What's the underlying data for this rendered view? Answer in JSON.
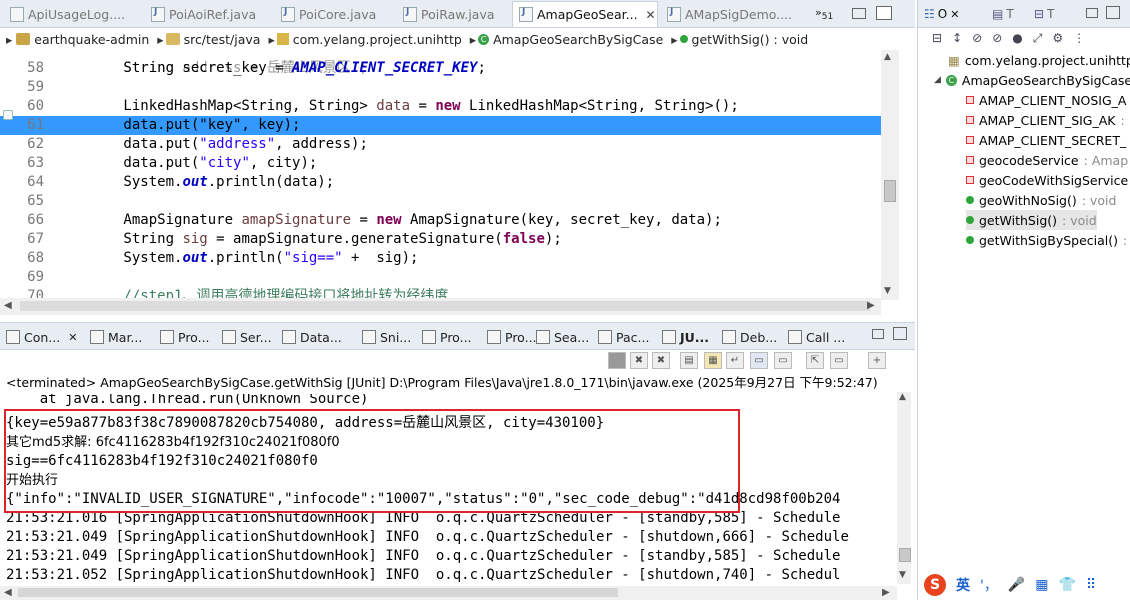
{
  "editor_tabs": [
    {
      "label": "ApiUsageLog....",
      "active": false
    },
    {
      "label": "PoiAoiRef.java",
      "active": false
    },
    {
      "label": "PoiCore.java",
      "active": false
    },
    {
      "label": "PoiRaw.java",
      "active": false
    },
    {
      "label": "AmapGeoSear...",
      "active": true
    },
    {
      "label": "AMapSigDemo....",
      "active": false
    }
  ],
  "overflow_count": "51",
  "breadcrumb": [
    "earthquake-admin",
    "src/test/java",
    "com.yelang.project.unihttp",
    "AmapGeoSearchBySigCase",
    "getWithSig() : void"
  ],
  "code_lines": [
    {
      "n": "58",
      "tokens": [
        {
          "t": "        String secret_key = ",
          "c": ""
        },
        {
          "t": "AMAP_CLIENT_SECRET_KEY",
          "c": "const"
        },
        {
          "t": ";",
          "c": ""
        }
      ]
    },
    {
      "n": "59",
      "tokens": []
    },
    {
      "n": "60",
      "tokens": [
        {
          "t": "        LinkedHashMap<String, String> ",
          "c": ""
        },
        {
          "t": "data",
          "c": "var"
        },
        {
          "t": " = ",
          "c": ""
        },
        {
          "t": "new",
          "c": "kw"
        },
        {
          "t": " LinkedHashMap<String, String>();",
          "c": ""
        }
      ]
    },
    {
      "n": "61",
      "tokens": [
        {
          "t": "        data.put(\"key\", key);",
          "c": ""
        }
      ],
      "highlight": true
    },
    {
      "n": "62",
      "tokens": [
        {
          "t": "        data.put(",
          "c": ""
        },
        {
          "t": "\"address\"",
          "c": "str"
        },
        {
          "t": ", address);",
          "c": ""
        }
      ]
    },
    {
      "n": "63",
      "tokens": [
        {
          "t": "        data.put(",
          "c": ""
        },
        {
          "t": "\"city\"",
          "c": "str"
        },
        {
          "t": ", city);",
          "c": ""
        }
      ]
    },
    {
      "n": "64",
      "tokens": [
        {
          "t": "        System.",
          "c": ""
        },
        {
          "t": "out",
          "c": "fld"
        },
        {
          "t": ".println(data);",
          "c": ""
        }
      ]
    },
    {
      "n": "65",
      "tokens": []
    },
    {
      "n": "66",
      "tokens": [
        {
          "t": "        AmapSignature ",
          "c": ""
        },
        {
          "t": "amapSignature",
          "c": "var"
        },
        {
          "t": " = ",
          "c": ""
        },
        {
          "t": "new",
          "c": "kw"
        },
        {
          "t": " AmapSignature(key, secret_key, data);",
          "c": ""
        }
      ]
    },
    {
      "n": "67",
      "tokens": [
        {
          "t": "        String ",
          "c": ""
        },
        {
          "t": "sig",
          "c": "var"
        },
        {
          "t": " = amapSignature.generateSignature(",
          "c": ""
        },
        {
          "t": "false",
          "c": "kw"
        },
        {
          "t": ");",
          "c": ""
        }
      ]
    },
    {
      "n": "68",
      "tokens": [
        {
          "t": "        System.",
          "c": ""
        },
        {
          "t": "out",
          "c": "fld"
        },
        {
          "t": ".println(",
          "c": ""
        },
        {
          "t": "\"sig==\"",
          "c": "str"
        },
        {
          "t": " +  sig);",
          "c": ""
        }
      ]
    },
    {
      "n": "69",
      "tokens": []
    },
    {
      "n": "70",
      "tokens": [
        {
          "t": "        //step1、调用高德地理编码接口将地址转为经纬度",
          "c": "cmt"
        }
      ]
    }
  ],
  "outline": {
    "tabs": [
      "O",
      "T",
      "T"
    ],
    "package": "com.yelang.project.unihttp",
    "class_name": "AmapGeoSearchBySigCase",
    "members": [
      {
        "icon": "static-final-field",
        "name": "AMAP_CLIENT_NOSIG_A",
        "type": ""
      },
      {
        "icon": "static-final-field",
        "name": "AMAP_CLIENT_SIG_AK",
        "type": " :"
      },
      {
        "icon": "static-final-field",
        "name": "AMAP_CLIENT_SECRET_",
        "type": ""
      },
      {
        "icon": "private-field",
        "name": "geocodeService",
        "type": " : Amap"
      },
      {
        "icon": "private-field",
        "name": "geoCodeWithSigService",
        "type": ""
      },
      {
        "icon": "public-method",
        "name": "geoWithNoSig()",
        "type": " : void"
      },
      {
        "icon": "public-method",
        "name": "getWithSig()",
        "type": " : void"
      },
      {
        "icon": "public-method",
        "name": "getWithSigBySpecial()",
        "type": " :"
      }
    ]
  },
  "console_tabs": [
    "Con...",
    "Mar...",
    "Pro...",
    "Ser...",
    "Data...",
    "Sni...",
    "Pro...",
    "Pro...",
    "Sea...",
    "Pac...",
    "JU...",
    "Deb...",
    "Call ..."
  ],
  "terminated_line": "<terminated> AmapGeoSearchBySigCase.getWithSig [JUnit] D:\\Program Files\\Java\\jre1.8.0_171\\bin\\javaw.exe (2025年9月27日 下午9:52:47)",
  "console_lines": [
    {
      "text": "    at java.lang.Thread.run(Unknown Source)",
      "cjk": false
    },
    {
      "text": "{key=e59a877b83f38c7890087820cb754080, address=岳麓山风景区, city=430100}",
      "cjk": false
    },
    {
      "text": "其它md5求解: 6fc4116283b4f192f310c24021f080f0",
      "cjk": true
    },
    {
      "text": "sig==6fc4116283b4f192f310c24021f080f0",
      "cjk": false
    },
    {
      "text": "开始执行",
      "cjk": true
    },
    {
      "text": "{\"info\":\"INVALID_USER_SIGNATURE\",\"infocode\":\"10007\",\"status\":\"0\",\"sec_code_debug\":\"d41d8cd98f00b204",
      "cjk": false
    },
    {
      "text": "21:53:21.016 [SpringApplicationShutdownHook] INFO  o.q.c.QuartzScheduler - [standby,585] - Schedule",
      "cjk": false
    },
    {
      "text": "21:53:21.049 [SpringApplicationShutdownHook] INFO  o.q.c.QuartzScheduler - [shutdown,666] - Schedule",
      "cjk": false
    },
    {
      "text": "21:53:21.049 [SpringApplicationShutdownHook] INFO  o.q.c.QuartzScheduler - [standby,585] - Schedule",
      "cjk": false
    },
    {
      "text": "21:53:21.052 [SpringApplicationShutdownHook] INFO  o.q.c.QuartzScheduler - [shutdown,740] - Schedul",
      "cjk": false
    }
  ],
  "ime": {
    "label": "英"
  },
  "colors": {
    "highlight": "#3399ff",
    "redbox": "#e0242b",
    "keyword": "#7f0055",
    "string": "#2a00ff"
  }
}
